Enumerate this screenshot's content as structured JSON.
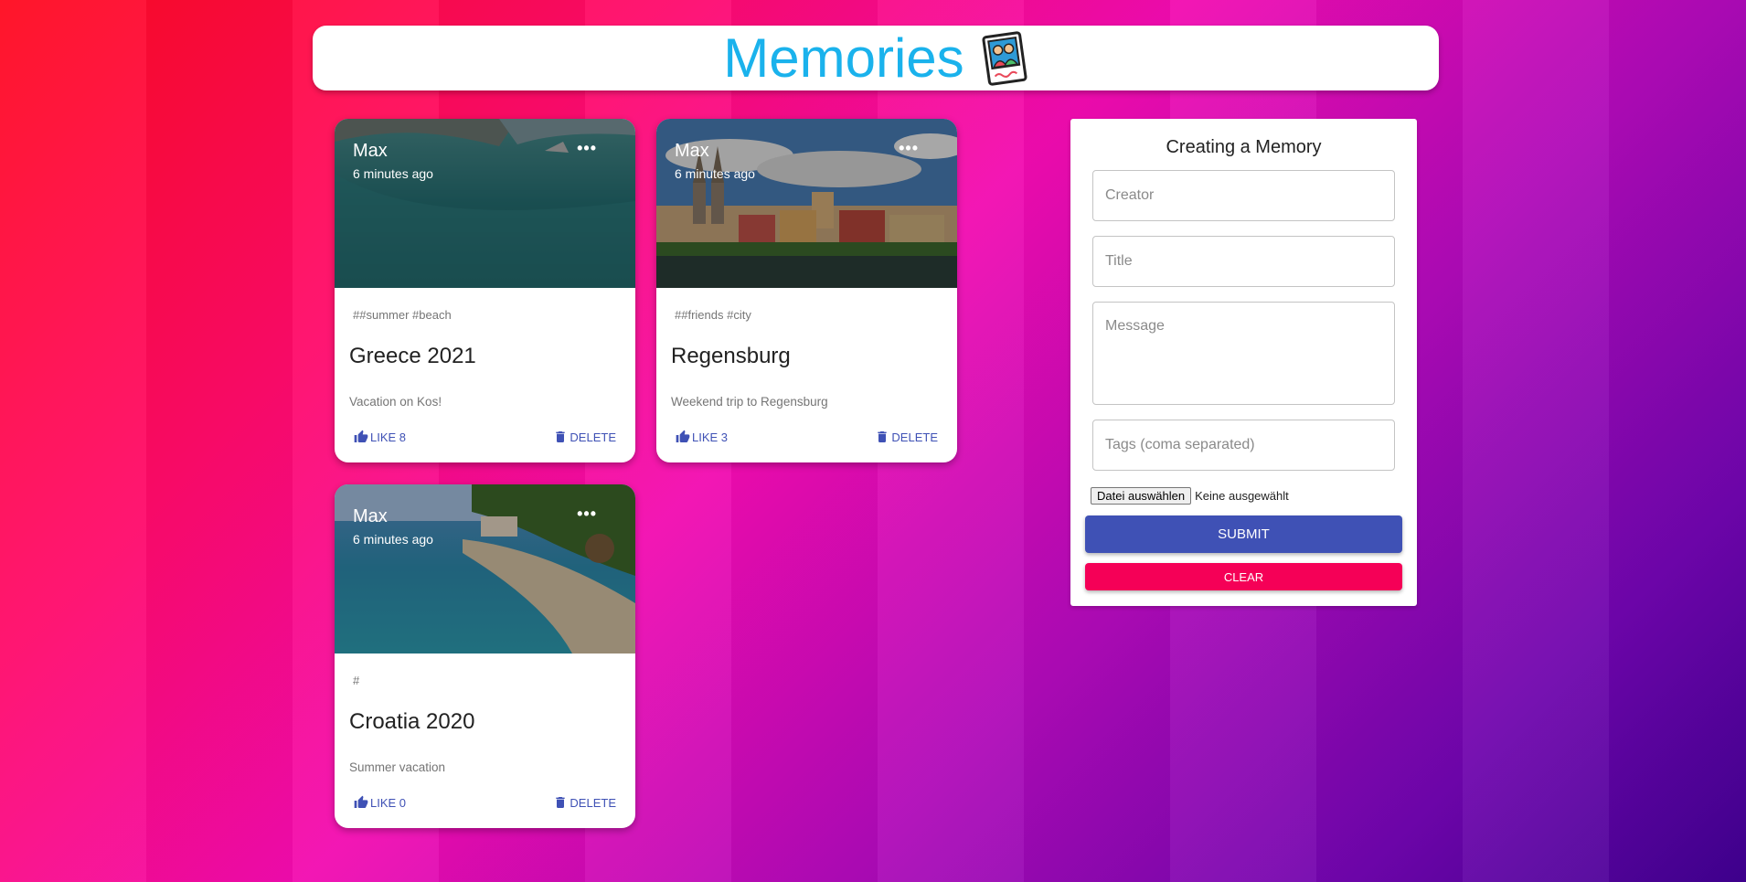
{
  "app": {
    "title": "Memories"
  },
  "posts": [
    {
      "creator": "Max",
      "time": "6 minutes ago",
      "tags": "##summer #beach",
      "title": "Greece 2021",
      "message": "Vacation on Kos!",
      "like_label": "LIKE 8",
      "delete_label": "DELETE"
    },
    {
      "creator": "Max",
      "time": "6 minutes ago",
      "tags": "##friends #city",
      "title": "Regensburg",
      "message": "Weekend trip to Regensburg",
      "like_label": "LIKE 3",
      "delete_label": "DELETE"
    },
    {
      "creator": "Max",
      "time": "6 minutes ago",
      "tags": "#",
      "title": "Croatia 2020",
      "message": "Summer vacation",
      "like_label": "LIKE 0",
      "delete_label": "DELETE"
    }
  ],
  "form": {
    "heading": "Creating a Memory",
    "creator_placeholder": "Creator",
    "title_placeholder": "Title",
    "message_placeholder": "Message",
    "tags_placeholder": "Tags (coma separated)",
    "file_button_label": "Datei auswählen",
    "file_status": "Keine ausgewählt",
    "submit_label": "SUBMIT",
    "clear_label": "CLEAR"
  },
  "colors": {
    "title": "#1ab2ec",
    "primary": "#3f51b5",
    "secondary": "#f50057"
  },
  "icons": {
    "logo": "memories-photo-icon",
    "more": "more-horiz-icon",
    "like": "thumb-up-icon",
    "delete": "trash-icon"
  }
}
